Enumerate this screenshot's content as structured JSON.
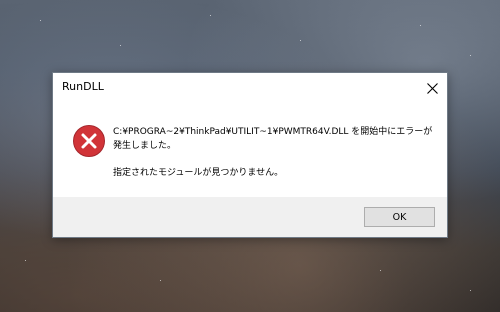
{
  "dialog": {
    "title": "RunDLL",
    "message_line1": "C:¥PROGRA~2¥ThinkPad¥UTILIT~1¥PWMTR64V.DLL を開始中にエラーが発生しました。",
    "message_line2": "指定されたモジュールが見つかりません。",
    "ok_label": "OK",
    "icons": {
      "close": "close-icon",
      "error": "error-icon"
    }
  },
  "colors": {
    "error_red": "#d13438",
    "button_bg": "#e1e1e1",
    "footer_bg": "#f0f0f0"
  }
}
